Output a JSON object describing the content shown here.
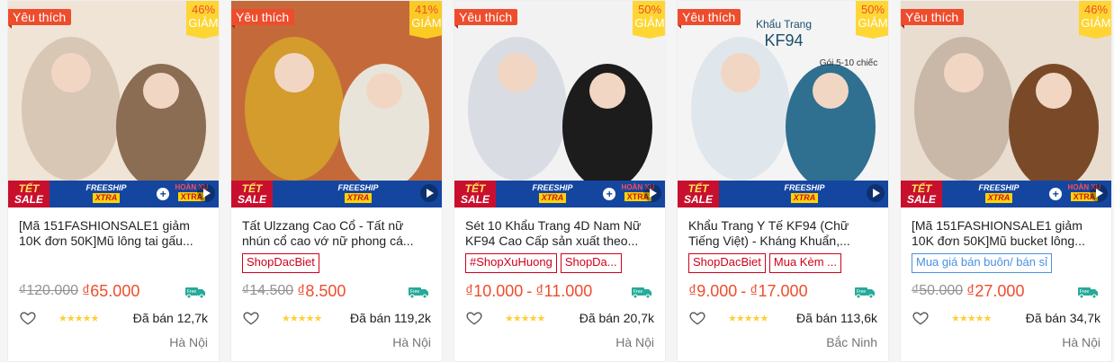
{
  "products": [
    {
      "favorite_badge": "Yêu thích",
      "discount": {
        "pct": "46%",
        "label": "GIẢM"
      },
      "promo": {
        "tet_top": "TẾT",
        "tet_bottom": "SALE",
        "freeship": "FREESHIP",
        "xtra": "XTRA",
        "hoanxu": "HOÀN XU",
        "hoanxu_xtra": "XTRA"
      },
      "name": "[Mã 151FASHIONSALE1 giảm 10K đơn 50K]Mũ lông tai gấu...",
      "tags": [],
      "price_old": "₫120.000",
      "price": "₫65.000",
      "price_max": "",
      "stars": "★★★★★",
      "sold": "Đã bán 12,7k",
      "location": "Hà Nội",
      "colors": [
        "#d8c7b4",
        "#8a6d52",
        "#efe4d6"
      ]
    },
    {
      "favorite_badge": "Yêu thích",
      "discount": {
        "pct": "41%",
        "label": "GIẢM"
      },
      "promo": {
        "tet_top": "TẾT",
        "tet_bottom": "SALE",
        "freeship": "FREESHIP",
        "xtra": "XTRA",
        "hoanxu": "",
        "hoanxu_xtra": ""
      },
      "name": "Tất Ulzzang Cao Cổ - Tất nữ nhún cổ cao vớ nữ phong cá...",
      "tags": [
        {
          "text": "ShopDacBiet",
          "style": "red"
        }
      ],
      "price_old": "₫14.500",
      "price": "₫8.500",
      "price_max": "",
      "stars": "★★★★★",
      "sold": "Đã bán 119,2k",
      "location": "Hà Nội",
      "colors": [
        "#d49b2d",
        "#e9e4da",
        "#c46a3a"
      ]
    },
    {
      "favorite_badge": "Yêu thích",
      "discount": {
        "pct": "50%",
        "label": "GIẢM"
      },
      "promo": {
        "tet_top": "TẾT",
        "tet_bottom": "SALE",
        "freeship": "FREESHIP",
        "xtra": "XTRA",
        "hoanxu": "HOÀN XU",
        "hoanxu_xtra": "XTRA"
      },
      "name": "Sét 10 Khẩu Trang 4D Nam Nữ KF94 Cao Cấp sản xuất theo...",
      "tags": [
        {
          "text": "#ShopXuHuong",
          "style": "red"
        },
        {
          "text": "ShopDa...",
          "style": "red"
        }
      ],
      "price_old": "",
      "price": "₫10.000",
      "price_max": "₫11.000",
      "stars": "★★★★★",
      "sold": "Đã bán 20,7k",
      "location": "Hà Nội",
      "colors": [
        "#d9dde3",
        "#1c1c1c",
        "#f2f2f2"
      ]
    },
    {
      "favorite_badge": "Yêu thích",
      "discount": {
        "pct": "50%",
        "label": "GIẢM"
      },
      "promo": {
        "tet_top": "TẾT",
        "tet_bottom": "SALE",
        "freeship": "FREESHIP",
        "xtra": "XTRA",
        "hoanxu": "",
        "hoanxu_xtra": ""
      },
      "name": "Khẩu Trang Y Tế KF94 (Chữ Tiếng Việt) - Kháng Khuẩn,...",
      "tags": [
        {
          "text": "ShopDacBiet",
          "style": "red"
        },
        {
          "text": "Mua Kèm ...",
          "style": "red"
        }
      ],
      "price_old": "",
      "price": "₫9.000",
      "price_max": "₫17.000",
      "stars": "★★★★★",
      "sold": "Đã bán 113,6k",
      "location": "Bắc Ninh",
      "colors": [
        "#dfe7ec",
        "#2f6f8f",
        "#f4f4f4"
      ],
      "image_text": {
        "brand": "Khẩu Trang",
        "model": "KF94",
        "pack": "Gói 5-10 chiếc"
      }
    },
    {
      "favorite_badge": "Yêu thích",
      "discount": {
        "pct": "46%",
        "label": "GIẢM"
      },
      "promo": {
        "tet_top": "TẾT",
        "tet_bottom": "SALE",
        "freeship": "FREESHIP",
        "xtra": "XTRA",
        "hoanxu": "HOÀN XU",
        "hoanxu_xtra": "XTRA"
      },
      "name": "[Mã 151FASHIONSALE1 giảm 10K đơn 50K]Mũ bucket lông...",
      "tags": [
        {
          "text": "Mua giá bán buôn/ bán sỉ",
          "style": "blue"
        }
      ],
      "price_old": "₫50.000",
      "price": "₫27.000",
      "price_max": "",
      "stars": "★★★★★",
      "sold": "Đã bán 34,7k",
      "location": "Hà Nội",
      "colors": [
        "#c9b8a8",
        "#7a4a28",
        "#e9ddd0"
      ]
    }
  ],
  "accent": "#ee4d2d",
  "icons": {
    "heart": "heart-outline-icon",
    "free_ship": "free-shipping-truck-icon",
    "play": "video-play-icon"
  }
}
